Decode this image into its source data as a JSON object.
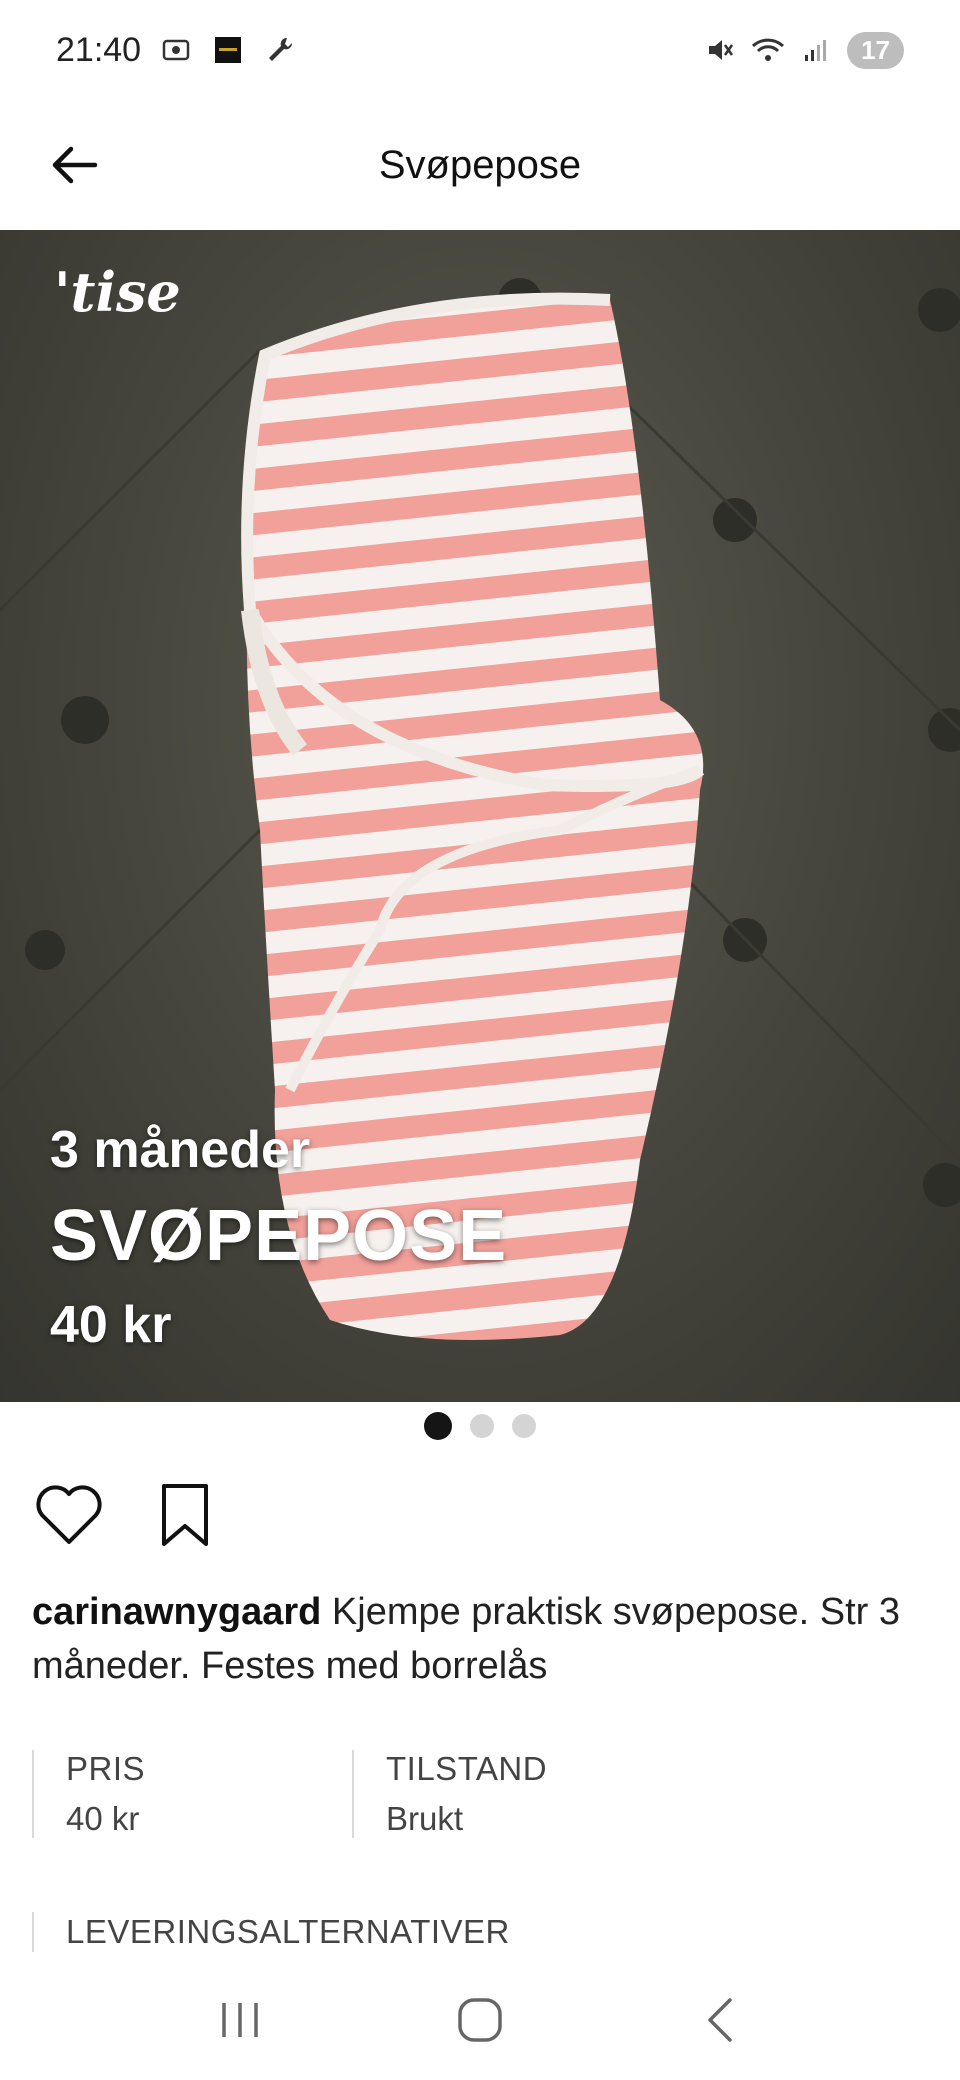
{
  "status_bar": {
    "time": "21:40",
    "notification_count": "17"
  },
  "header": {
    "title": "Svøpepose"
  },
  "photo": {
    "logo_text": "'tise",
    "size_text": "3 måneder",
    "title_text": "SVØPEPOSE",
    "price_text": "40 kr",
    "total_images": 3,
    "active_image": 1
  },
  "post": {
    "username": "carinawnygaard",
    "description": " Kjempe praktisk svøpepose. Str 3 måneder. Festes med borrelås"
  },
  "details": {
    "price_label": "PRIS",
    "price_value": "40 kr",
    "condition_label": "TILSTAND",
    "condition_value": "Brukt",
    "delivery_label": "LEVERINGSALTERNATIVER"
  },
  "colors": {
    "stripe_pink": "#f2a09a",
    "stripe_white": "#f6f1ee",
    "background": "#4a4a42"
  }
}
